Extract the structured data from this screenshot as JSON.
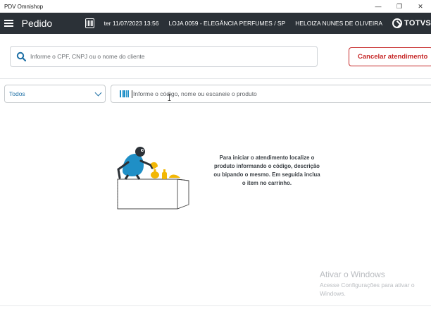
{
  "window": {
    "title": "PDV Omnishop",
    "controls": {
      "minimize": "—",
      "restore": "❐",
      "close": "✕"
    }
  },
  "header": {
    "menu_icon": "hamburger-menu-icon",
    "title": "Pedido",
    "barcode_icon": "barcode-scanner-icon",
    "datetime": "ter 11/07/2023 13:56",
    "store": "LOJA 0059 - ELEGÂNCIA PERFUMES / SP",
    "user": "HELOIZA NUNES DE OLIVEIRA",
    "brand": "TOTVS",
    "background": "#2b3137"
  },
  "client_search": {
    "icon": "search-icon",
    "placeholder": "Informe o CPF, CNPJ ou o nome do cliente"
  },
  "cancel_button": {
    "label": "Cancelar atendimento",
    "color": "#c62828"
  },
  "filter": {
    "selected": "Todos",
    "icon": "chevron-down-icon",
    "accent": "#1d6fa5"
  },
  "product_search": {
    "icon": "barcode-icon",
    "placeholder": "Informe o código, nome ou escaneie o produto",
    "icon_color": "#1d8fc7"
  },
  "empty_state": {
    "illustration": "seller-with-perfumes-illustration",
    "message": "Para iniciar o atendimento localize o produto informando o código, descrição ou bipando o mesmo. Em seguida inclua o item no carrinho."
  },
  "watermark": {
    "title": "Ativar o Windows",
    "subtitle": "Acesse Configurações para ativar o Windows."
  }
}
